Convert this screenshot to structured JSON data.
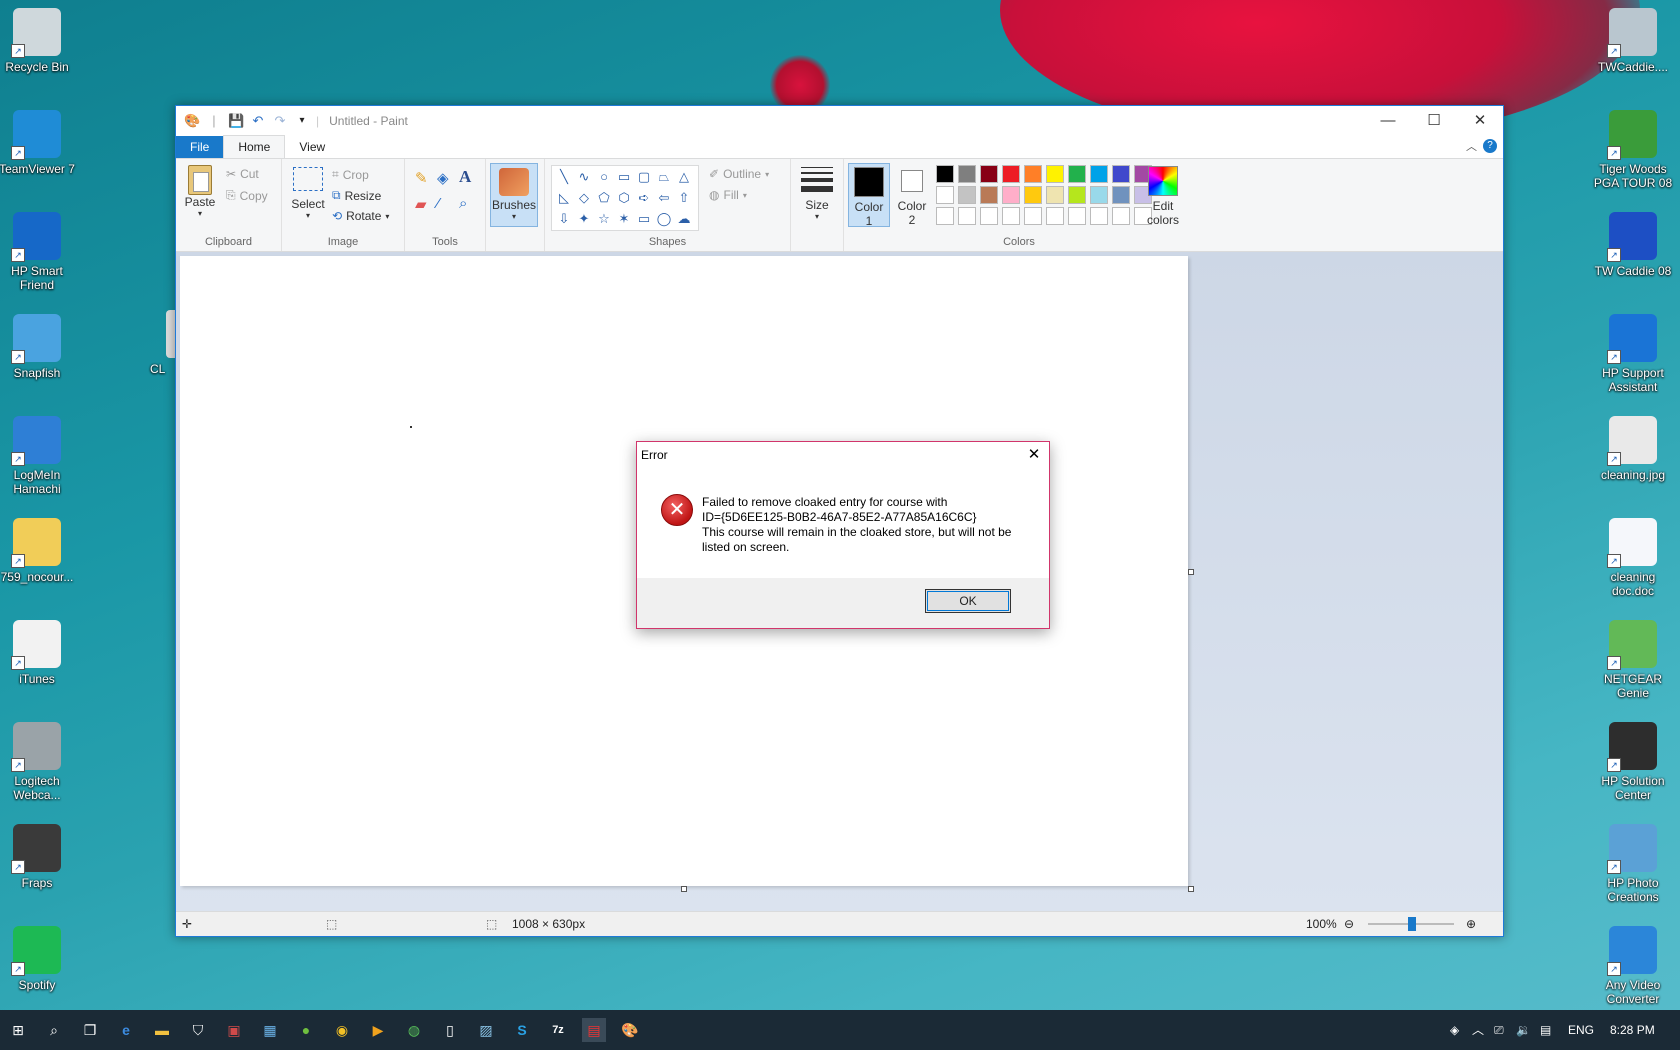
{
  "desktop": {
    "left_icons": [
      {
        "label": "Recycle Bin",
        "icon": "recycle-bin-icon",
        "color": "#cfd8dc"
      },
      {
        "label": "TeamViewer 7",
        "icon": "teamviewer-icon",
        "color": "#1f8cd6"
      },
      {
        "label": "HP Smart Friend",
        "icon": "hp-smart-friend-icon",
        "color": "#1668c8"
      },
      {
        "label": "Snapfish",
        "icon": "snapfish-icon",
        "color": "#4aa3e0"
      },
      {
        "label": "LogMeIn Hamachi",
        "icon": "hamachi-icon",
        "color": "#2e7fd6"
      },
      {
        "label": "759_nocour...",
        "icon": "zip-folder-icon",
        "color": "#f1cd58"
      },
      {
        "label": "iTunes",
        "icon": "itunes-icon",
        "color": "#f2f2f2"
      },
      {
        "label": "Logitech Webca...",
        "icon": "webcam-icon",
        "color": "#9aa3a8"
      },
      {
        "label": "Fraps",
        "icon": "fraps-icon",
        "color": "#3a3a3a"
      },
      {
        "label": "Spotify",
        "icon": "spotify-icon",
        "color": "#1db954"
      }
    ],
    "right_icons": [
      {
        "label": "TWCaddie....",
        "icon": "twcaddie-installer-icon",
        "color": "#b9c6cf"
      },
      {
        "label": "Tiger Woods PGA TOUR 08",
        "icon": "tiger-woods-icon",
        "color": "#3a9c3a"
      },
      {
        "label": "TW Caddie 08",
        "icon": "tw-caddie-icon",
        "color": "#1d4fc4"
      },
      {
        "label": "HP Support Assistant",
        "icon": "hp-support-icon",
        "color": "#1a74d6"
      },
      {
        "label": "cleaning.jpg",
        "icon": "image-file-icon",
        "color": "#e9e9e9"
      },
      {
        "label": "cleaning doc.doc",
        "icon": "word-doc-icon",
        "color": "#f5f7fb"
      },
      {
        "label": "NETGEAR Genie",
        "icon": "netgear-genie-icon",
        "color": "#62b957"
      },
      {
        "label": "HP Solution Center",
        "icon": "hp-solution-icon",
        "color": "#2d2d2d"
      },
      {
        "label": "HP Photo Creations",
        "icon": "hp-photo-icon",
        "color": "#5ba1d6"
      },
      {
        "label": "Any Video Converter",
        "icon": "video-converter-icon",
        "color": "#2b86d9"
      }
    ],
    "partial_icon_label": "CL"
  },
  "paint": {
    "title": "Untitled - Paint",
    "tabs": {
      "file": "File",
      "home": "Home",
      "view": "View"
    },
    "clipboard": {
      "paste": "Paste",
      "cut": "Cut",
      "copy": "Copy",
      "label": "Clipboard"
    },
    "image": {
      "select": "Select",
      "crop": "Crop",
      "resize": "Resize",
      "rotate": "Rotate",
      "label": "Image"
    },
    "tools": {
      "label": "Tools"
    },
    "brushes": "Brushes",
    "shapes": {
      "outline": "Outline",
      "fill": "Fill",
      "label": "Shapes"
    },
    "size": "Size",
    "colors": {
      "color1_line1": "Color",
      "color1_line2": "1",
      "color2_line1": "Color",
      "color2_line2": "2",
      "edit_line1": "Edit",
      "edit_line2": "colors",
      "label": "Colors",
      "row1": [
        "#000000",
        "#7f7f7f",
        "#880015",
        "#ed1c24",
        "#ff7f27",
        "#fff200",
        "#22b14c",
        "#00a2e8",
        "#3f48cc",
        "#a349a4"
      ],
      "row2": [
        "#ffffff",
        "#c3c3c3",
        "#b97a57",
        "#ffaec9",
        "#ffc90e",
        "#efe4b0",
        "#b5e61d",
        "#99d9ea",
        "#7092be",
        "#c8bfe7"
      ],
      "row3": [
        "#ffffff",
        "#ffffff",
        "#ffffff",
        "#ffffff",
        "#ffffff",
        "#ffffff",
        "#ffffff",
        "#ffffff",
        "#ffffff",
        "#ffffff"
      ]
    },
    "status": {
      "dimensions": "1008 × 630px",
      "zoom": "100%"
    }
  },
  "dialog": {
    "title": "Error",
    "line1": "Failed to remove cloaked entry for course with",
    "line2": "ID={5D6EE125-B0B2-46A7-85E2-A77A85A16C6C}",
    "line3": "This course will remain in the cloaked store, but will not be",
    "line4": "listed on screen.",
    "ok": "OK"
  },
  "taskbar": {
    "language": "ENG",
    "time": "8:28 PM"
  }
}
